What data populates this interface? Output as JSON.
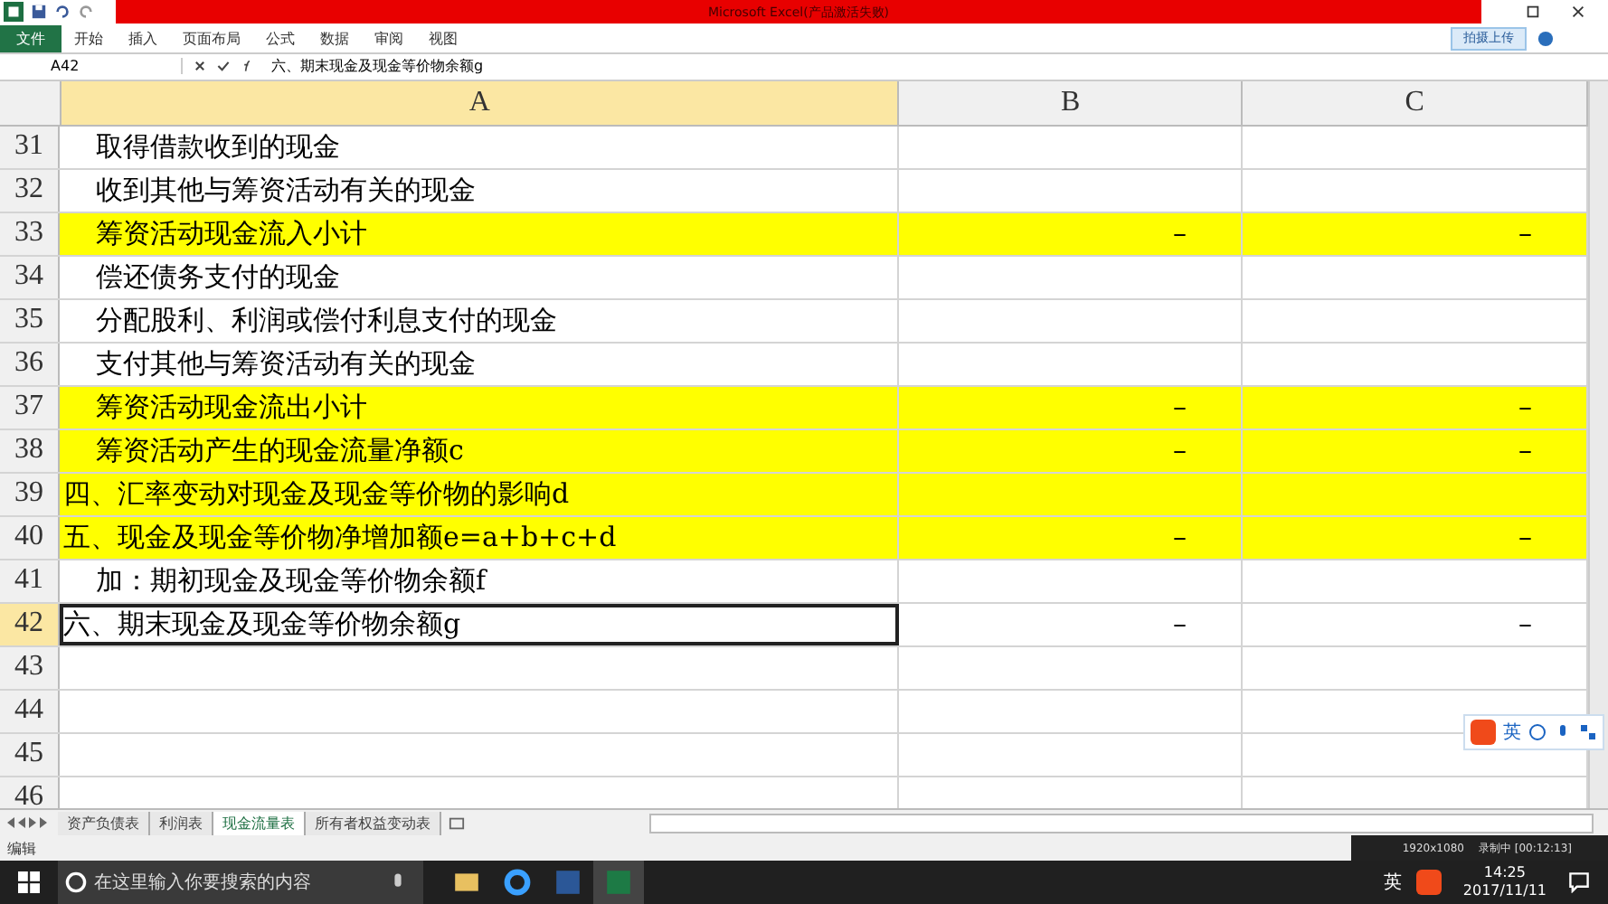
{
  "window": {
    "title": "Microsoft Excel(产品激活失败)"
  },
  "ribbon_tabs": [
    {
      "label": "文件",
      "selected": true
    },
    {
      "label": "开始",
      "selected": false
    },
    {
      "label": "插入",
      "selected": false
    },
    {
      "label": "页面布局",
      "selected": false
    },
    {
      "label": "公式",
      "selected": false
    },
    {
      "label": "数据",
      "selected": false
    },
    {
      "label": "审阅",
      "selected": false
    },
    {
      "label": "视图",
      "selected": false
    }
  ],
  "upload_button": "拍摄上传",
  "formula_bar": {
    "name_box": "A42",
    "formula": "六、期末现金及现金等价物余额g"
  },
  "columns": [
    "A",
    "B",
    "C"
  ],
  "rows": [
    {
      "num": "31",
      "text": "取得借款收到的现金",
      "indent": true,
      "highlight": false,
      "selected": false,
      "b": "",
      "c": ""
    },
    {
      "num": "32",
      "text": "收到其他与筹资活动有关的现金",
      "indent": true,
      "highlight": false,
      "selected": false,
      "b": "",
      "c": ""
    },
    {
      "num": "33",
      "text": "筹资活动现金流入小计",
      "indent": true,
      "highlight": true,
      "selected": false,
      "b": "–",
      "c": "–"
    },
    {
      "num": "34",
      "text": "偿还债务支付的现金",
      "indent": true,
      "highlight": false,
      "selected": false,
      "b": "",
      "c": ""
    },
    {
      "num": "35",
      "text": "分配股利、利润或偿付利息支付的现金",
      "indent": true,
      "highlight": false,
      "selected": false,
      "b": "",
      "c": ""
    },
    {
      "num": "36",
      "text": "支付其他与筹资活动有关的现金",
      "indent": true,
      "highlight": false,
      "selected": false,
      "b": "",
      "c": ""
    },
    {
      "num": "37",
      "text": "筹资活动现金流出小计",
      "indent": true,
      "highlight": true,
      "selected": false,
      "b": "–",
      "c": "–"
    },
    {
      "num": "38",
      "text": "筹资活动产生的现金流量净额c",
      "indent": true,
      "highlight": true,
      "selected": false,
      "b": "–",
      "c": "–"
    },
    {
      "num": "39",
      "text": "四、汇率变动对现金及现金等价物的影响d",
      "indent": false,
      "highlight": true,
      "selected": false,
      "b": "",
      "c": ""
    },
    {
      "num": "40",
      "text": "五、现金及现金等价物净增加额e=a+b+c+d",
      "indent": false,
      "highlight": true,
      "selected": false,
      "b": "–",
      "c": "–"
    },
    {
      "num": "41",
      "text": "加：期初现金及现金等价物余额f",
      "indent": true,
      "highlight": false,
      "selected": false,
      "b": "",
      "c": ""
    },
    {
      "num": "42",
      "text": "六、期末现金及现金等价物余额g",
      "indent": false,
      "highlight": false,
      "selected": true,
      "b": "–",
      "c": "–"
    },
    {
      "num": "43",
      "text": "",
      "highlight": false,
      "selected": false,
      "b": "",
      "c": ""
    },
    {
      "num": "44",
      "text": "",
      "highlight": false,
      "selected": false,
      "b": "",
      "c": ""
    },
    {
      "num": "45",
      "text": "",
      "highlight": false,
      "selected": false,
      "b": "",
      "c": ""
    },
    {
      "num": "46",
      "text": "",
      "highlight": false,
      "selected": false,
      "b": "",
      "c": ""
    }
  ],
  "sheet_tabs": [
    {
      "label": "资产负债表",
      "selected": false
    },
    {
      "label": "利润表",
      "selected": false
    },
    {
      "label": "现金流量表",
      "selected": true
    },
    {
      "label": "所有者权益变动表",
      "selected": false
    }
  ],
  "status_bar": {
    "mode": "编辑",
    "resolution": "1920x1080",
    "recording": "录制中 [00:12:13]"
  },
  "ime": {
    "lang": "英"
  },
  "taskbar": {
    "search_placeholder": "在这里输入你要搜索的内容",
    "tray_lang": "英",
    "time": "14:25",
    "date": "2017/11/11"
  }
}
